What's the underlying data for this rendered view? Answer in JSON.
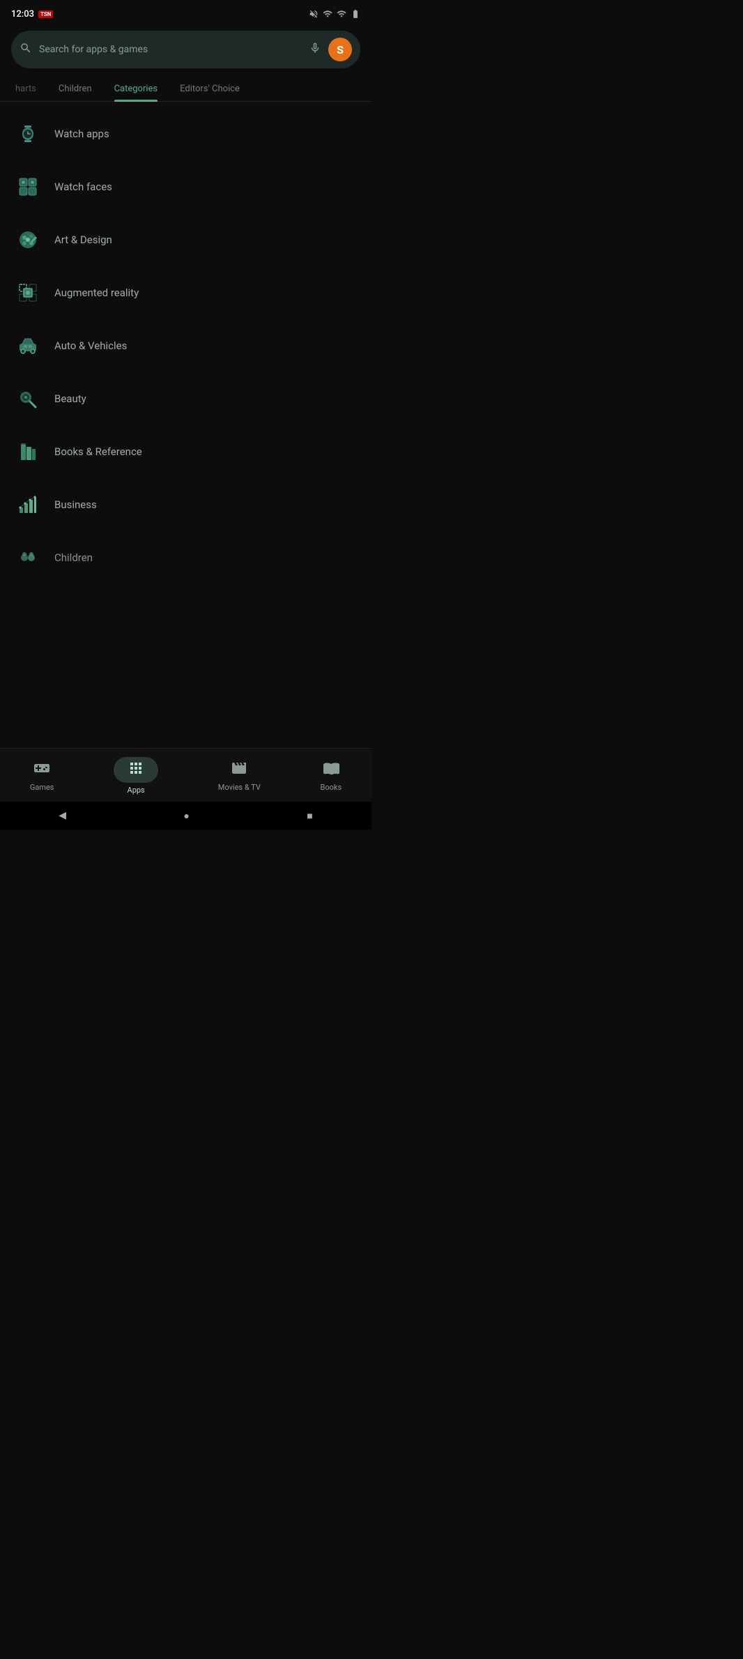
{
  "statusBar": {
    "time": "12:03",
    "badge": "TSN"
  },
  "search": {
    "placeholder": "Search for apps & games",
    "avatarLabel": "S"
  },
  "tabs": [
    {
      "id": "charts",
      "label": "harts",
      "active": false,
      "partial": true
    },
    {
      "id": "children",
      "label": "Children",
      "active": false,
      "partial": false
    },
    {
      "id": "categories",
      "label": "Categories",
      "active": true,
      "partial": false
    },
    {
      "id": "editors-choice",
      "label": "Editors' Choice",
      "active": false,
      "partial": false
    }
  ],
  "categories": [
    {
      "id": "watch-apps",
      "label": "Watch apps",
      "icon": "watch"
    },
    {
      "id": "watch-faces",
      "label": "Watch faces",
      "icon": "watch-faces"
    },
    {
      "id": "art-design",
      "label": "Art & Design",
      "icon": "art"
    },
    {
      "id": "augmented-reality",
      "label": "Augmented reality",
      "icon": "ar"
    },
    {
      "id": "auto-vehicles",
      "label": "Auto & Vehicles",
      "icon": "auto"
    },
    {
      "id": "beauty",
      "label": "Beauty",
      "icon": "beauty"
    },
    {
      "id": "books-reference",
      "label": "Books & Reference",
      "icon": "books"
    },
    {
      "id": "business",
      "label": "Business",
      "icon": "business"
    },
    {
      "id": "children",
      "label": "Children",
      "icon": "children"
    }
  ],
  "bottomNav": [
    {
      "id": "games",
      "label": "Games",
      "icon": "gamepad",
      "active": false
    },
    {
      "id": "apps",
      "label": "Apps",
      "icon": "apps-grid",
      "active": true
    },
    {
      "id": "movies-tv",
      "label": "Movies & TV",
      "icon": "film",
      "active": false
    },
    {
      "id": "books",
      "label": "Books",
      "icon": "book",
      "active": false
    }
  ],
  "systemNav": {
    "back": "◀",
    "home": "●",
    "recent": "■"
  }
}
